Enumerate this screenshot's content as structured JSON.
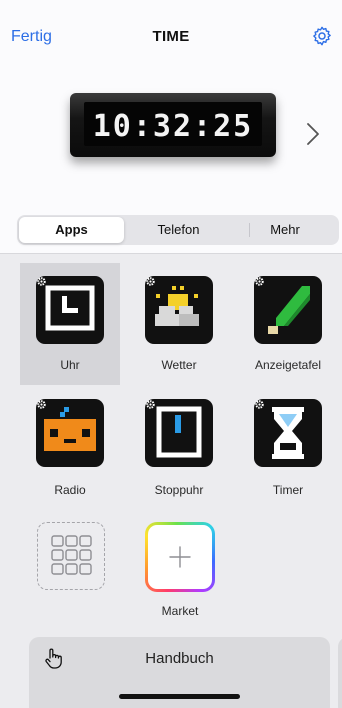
{
  "nav": {
    "done_label": "Fertig",
    "title": "TIME"
  },
  "device": {
    "time": "10:32:25"
  },
  "segments": [
    {
      "label": "Apps"
    },
    {
      "label": "Telefon"
    },
    {
      "label": "Mehr"
    }
  ],
  "apps": [
    {
      "label": "Uhr",
      "icon": "clock-icon",
      "selected": true
    },
    {
      "label": "Wetter",
      "icon": "weather-icon"
    },
    {
      "label": "Anzeigetafel",
      "icon": "scoreboard-icon"
    },
    {
      "label": "Radio",
      "icon": "radio-icon"
    },
    {
      "label": "Stoppuhr",
      "icon": "stopwatch-icon"
    },
    {
      "label": "Timer",
      "icon": "hourglass-icon"
    }
  ],
  "market": {
    "label": "Market"
  },
  "manual": {
    "title": "Handbuch"
  },
  "colors": {
    "accent": "#2c6ee6",
    "dark_tile": "#111111",
    "weather_yellow": "#f4d02a",
    "green": "#2fbb3f",
    "orange": "#f08a1a",
    "blue": "#2a9be6"
  }
}
